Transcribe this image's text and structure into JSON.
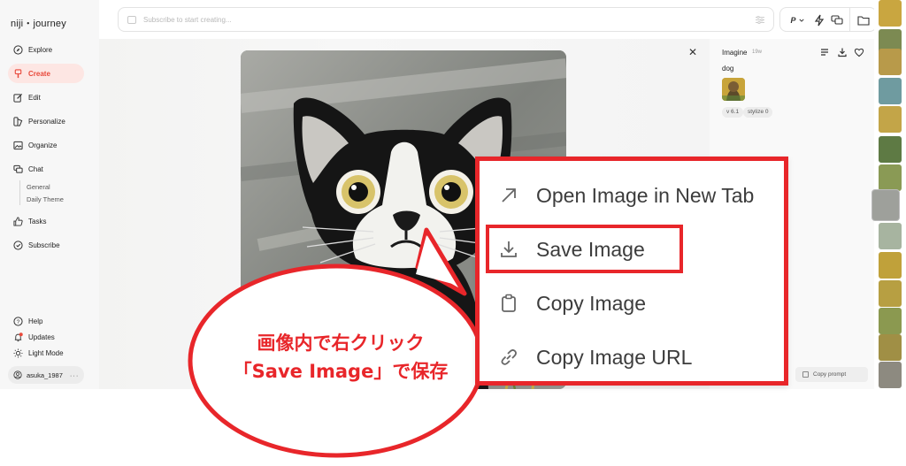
{
  "app": {
    "logo": "niji・journey"
  },
  "sidebar": {
    "items": [
      {
        "label": "Explore",
        "icon": "compass-icon"
      },
      {
        "label": "Create",
        "icon": "brush-icon",
        "active": true
      },
      {
        "label": "Edit",
        "icon": "edit-icon"
      },
      {
        "label": "Personalize",
        "icon": "personalize-icon"
      },
      {
        "label": "Organize",
        "icon": "image-icon"
      },
      {
        "label": "Chat",
        "icon": "chat-icon"
      }
    ],
    "chat_sub": [
      "General",
      "Daily Theme"
    ],
    "items_lower": [
      {
        "label": "Tasks",
        "icon": "thumbs-up-icon"
      },
      {
        "label": "Subscribe",
        "icon": "subscribe-icon"
      }
    ],
    "bottom": [
      {
        "label": "Help",
        "icon": "help-icon"
      },
      {
        "label": "Updates",
        "icon": "bell-icon"
      },
      {
        "label": "Light Mode",
        "icon": "sun-icon"
      }
    ],
    "user": "asuka_1987"
  },
  "search": {
    "placeholder": "Subscribe to start creating..."
  },
  "topbar": {
    "p_label": "P"
  },
  "detail": {
    "title": "Imagine",
    "time": "19w",
    "prompt": "dog",
    "tags": [
      "v 6.1",
      "stylize 0"
    ],
    "copy_prompt": "Copy prompt"
  },
  "context_menu": {
    "items": [
      {
        "label": "Open Image in New Tab",
        "icon": "open-new-tab-icon"
      },
      {
        "label": "Save Image",
        "icon": "download-icon"
      },
      {
        "label": "Copy Image",
        "icon": "clipboard-icon"
      },
      {
        "label": "Copy Image URL",
        "icon": "link-icon"
      }
    ]
  },
  "annotation": {
    "line1": "画像内で右クリック",
    "line2": "「Save Image」で保存"
  },
  "colors": {
    "accent": "#e8483a",
    "annotation_red": "#e8262a"
  }
}
